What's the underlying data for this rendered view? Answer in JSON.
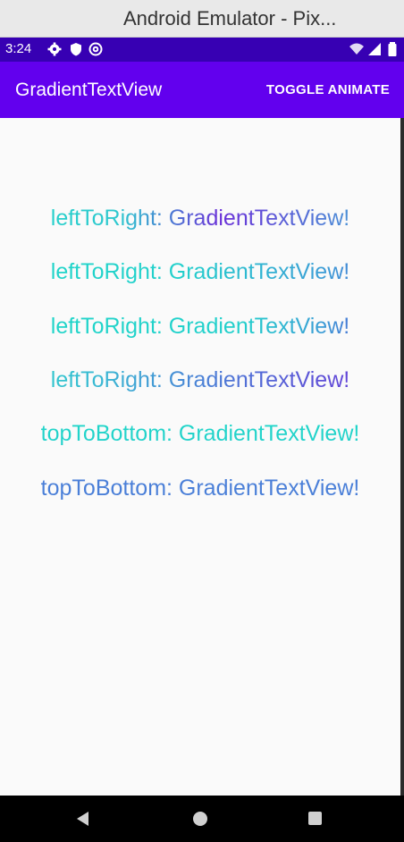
{
  "window": {
    "title": "Android Emulator - Pix..."
  },
  "status_bar": {
    "time": "3:24",
    "icons": [
      "gear-icon",
      "shield-icon",
      "at-icon",
      "wifi-icon",
      "signal-icon",
      "battery-icon"
    ]
  },
  "app_bar": {
    "title": "GradientTextView",
    "action_label": "TOGGLE ANIMATE",
    "color": "#6200ee",
    "status_color": "#3700b3"
  },
  "lines": [
    {
      "text": "leftToRight: GradientTextView!",
      "direction": "leftToRight"
    },
    {
      "text": "leftToRight: GradientTextView!",
      "direction": "leftToRight"
    },
    {
      "text": "leftToRight: GradientTextView!",
      "direction": "leftToRight"
    },
    {
      "text": "leftToRight: GradientTextView!",
      "direction": "leftToRight"
    },
    {
      "text": "topToBottom: GradientTextView!",
      "direction": "topToBottom"
    },
    {
      "text": "topToBottom: GradientTextView!",
      "direction": "topToBottom"
    }
  ],
  "gradient_colors": [
    "#1fd6c8",
    "#6a30d8"
  ],
  "nav_bar": {
    "buttons": [
      "back-icon",
      "home-icon",
      "recents-icon"
    ]
  }
}
